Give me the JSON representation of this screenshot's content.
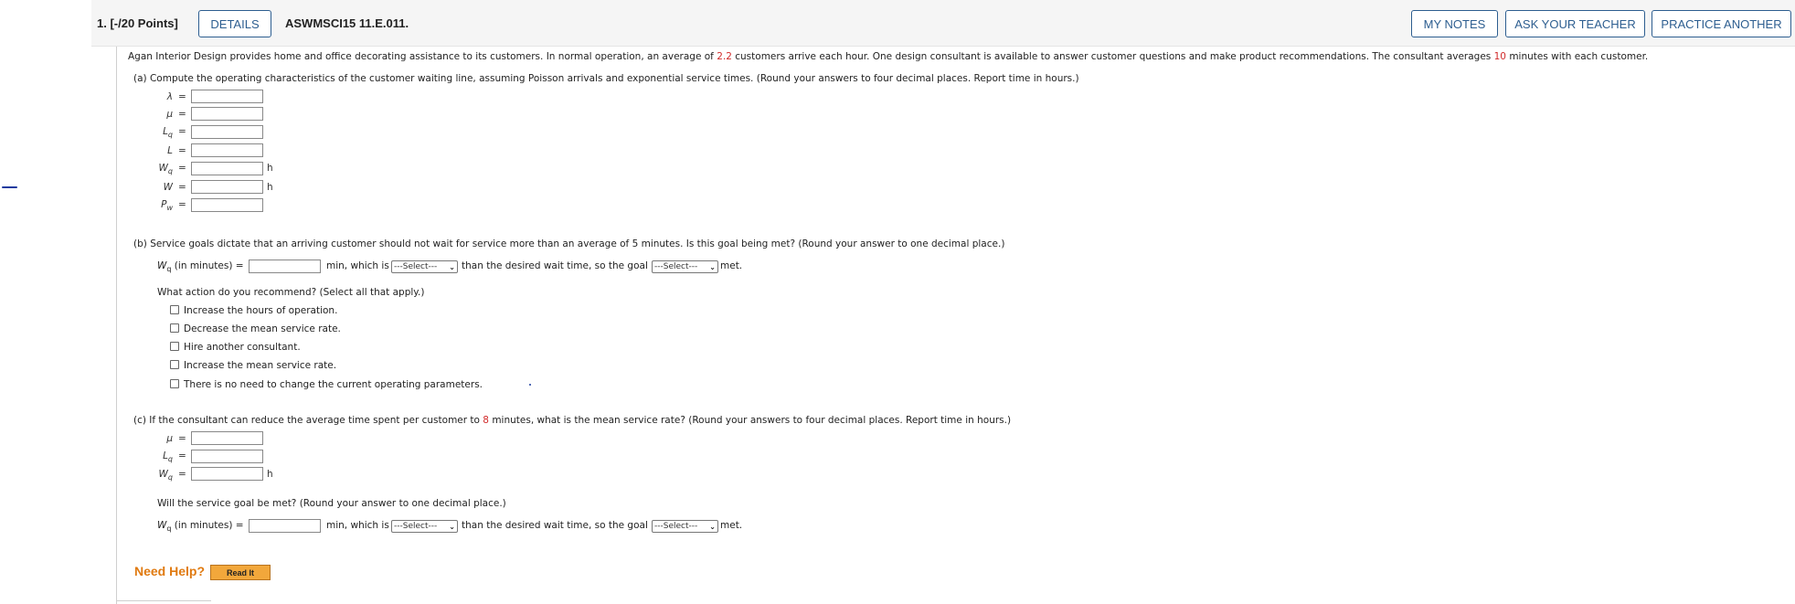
{
  "header": {
    "question_number": "1.  [-/20 Points]",
    "details_label": "DETAILS",
    "assignment_id": "ASWMSCI15 11.E.011.",
    "my_notes_label": "MY NOTES",
    "ask_teacher_label": "ASK YOUR TEACHER",
    "practice_another_label": "PRACTICE ANOTHER"
  },
  "intro": {
    "text_1": "Agan Interior Design provides home and office decorating assistance to its customers. In normal operation, an average of ",
    "arrival_value": "2.2",
    "text_2": " customers arrive each hour. One design consultant is available to answer customer questions and make product recommendations. The consultant averages ",
    "service_minutes": "10",
    "text_3": " minutes with each customer.",
    "accent_color": "#d12b2b"
  },
  "part_a": {
    "prompt": "(a)   Compute the operating characteristics of the customer waiting line, assuming Poisson arrivals and exponential service times. (Round your answers to four decimal places. Report time in hours.)",
    "fields": [
      {
        "label": "λ",
        "sub": "",
        "unit": "",
        "value": ""
      },
      {
        "label": "μ",
        "sub": "",
        "unit": "",
        "value": ""
      },
      {
        "label": "L",
        "sub": "q",
        "unit": "",
        "value": ""
      },
      {
        "label": "L",
        "sub": "",
        "unit": "",
        "value": ""
      },
      {
        "label": "W",
        "sub": "q",
        "unit": "h",
        "value": ""
      },
      {
        "label": "W",
        "sub": "",
        "unit": "h",
        "value": ""
      },
      {
        "label": "P",
        "sub": "w",
        "unit": "",
        "value": ""
      }
    ],
    "eq_sign": "="
  },
  "part_b": {
    "prompt": "(b)   Service goals dictate that an arriving customer should not wait for service more than an average of 5 minutes. Is this goal being met? (Round your answer to one decimal place.)",
    "wq_label": "W",
    "wq_sub": "q",
    "wq_suffix": " (in minutes) =",
    "min_text": "min, which is",
    "select1_value": "---Select---",
    "middle_text": "than the desired wait time, so the goal",
    "select2_value": "---Select---",
    "met_text": "met.",
    "action_question": "What action do you recommend? (Select all that apply.)",
    "options": [
      "Increase the hours of operation.",
      "Decrease the mean service rate.",
      "Hire another consultant.",
      "Increase the mean service rate.",
      "There is no need to change the current operating parameters."
    ]
  },
  "part_c": {
    "prompt_1": "(c)   If the consultant can reduce the average time spent per customer to ",
    "reduced_minutes": "8",
    "prompt_2": " minutes, what is the mean service rate? (Round your answers to four decimal places. Report time in hours.)",
    "fields": [
      {
        "label": "μ",
        "sub": "",
        "unit": ""
      },
      {
        "label": "L",
        "sub": "q",
        "unit": ""
      },
      {
        "label": "W",
        "sub": "q",
        "unit": "h"
      }
    ],
    "goal_question": "Will the service goal be met? (Round your answer to one decimal place.)",
    "wq_label": "W",
    "wq_sub": "q",
    "wq_suffix": " (in minutes) =",
    "min_text": "min, which is",
    "select1_value": "---Select---",
    "middle_text": "than the desired wait time, so the goal",
    "select2_value": "---Select---",
    "met_text": "met."
  },
  "help": {
    "need_help_label": "Need Help?",
    "read_it_label": "Read It"
  }
}
